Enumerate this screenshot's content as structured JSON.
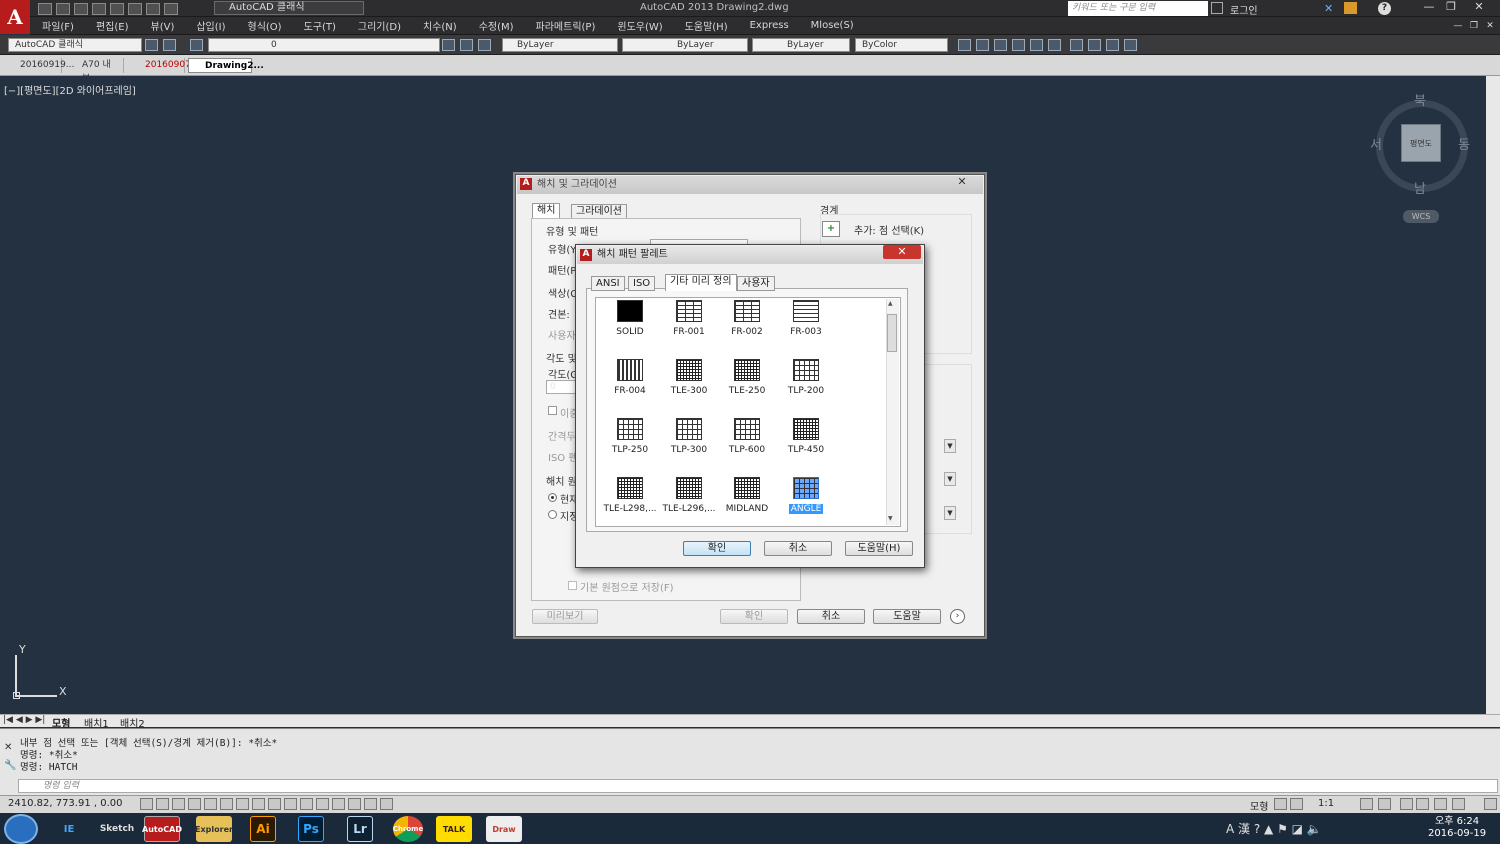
{
  "app": {
    "title": "AutoCAD 2013    Drawing2.dwg",
    "workspace": "AutoCAD 클래식",
    "search_placeholder": "키워드 또는 구문 입력",
    "login": "로그인",
    "logo_letter": "A"
  },
  "menu": [
    "파일(F)",
    "편집(E)",
    "뷰(V)",
    "삽입(I)",
    "형식(O)",
    "도구(T)",
    "그리기(D)",
    "치수(N)",
    "수정(M)",
    "파라메트릭(P)",
    "윈도우(W)",
    "도움말(H)",
    "Express",
    "Mlose(S)"
  ],
  "toolbar": {
    "workspace_combo": "AutoCAD 클래식",
    "layer_combo": "0",
    "color_combo": "ByLayer",
    "linetype_combo": "ByLayer",
    "lineweight_combo": "ByLayer",
    "plotstyle_combo": "ByColor"
  },
  "doc_tabs": [
    "20160919...",
    "A70 내부...",
    "20160907...",
    "Drawing2..."
  ],
  "view_label": "[−][평면도][2D 와이어프레임]",
  "navcube": {
    "north": "북",
    "south": "남",
    "west": "서",
    "east": "동",
    "face": "평면도",
    "wcs": "WCS"
  },
  "ucs": {
    "x": "X",
    "y": "Y"
  },
  "layout_tabs": [
    "모형",
    "배치1",
    "배치2"
  ],
  "command": {
    "lines": [
      "내부 점 선택 또는 [객체 선택(S)/경계 제거(B)]: *취소*",
      "명령: *취소*",
      "명령:  HATCH"
    ],
    "input_placeholder": "명령 입력"
  },
  "status": {
    "coords": "2410.82, 773.91 , 0.00",
    "model": "모형",
    "scale": "1:1"
  },
  "taskbar": {
    "time": "오후 6:24",
    "date": "2016-09-19",
    "apps": [
      "IE",
      "Sketch",
      "AutoCAD",
      "Explorer",
      "Ai",
      "Ps",
      "Lr",
      "Chrome",
      "TALK",
      "Draw"
    ]
  },
  "hatch_dialog": {
    "title": "해치 및 그라데이션",
    "tabs": [
      "해치",
      "그라데이션"
    ],
    "type_pattern_section": "유형 및 패턴",
    "labels_left": [
      "유형(Y)",
      "패턴(P)",
      "색상(C)",
      "견본:",
      "사용자"
    ],
    "angle_section": "각도 및",
    "angle_label": "각도(G)",
    "angle_value": "0",
    "labels_left2": [
      "이중",
      "간격두",
      "ISO 펜"
    ],
    "origin_section": "해치 원",
    "origin_opts": [
      "현재",
      "지정"
    ],
    "save_origin": "기본 원점으로 저장(F)",
    "boundaries_section": "경계",
    "add_pick": "추가: 점 선택(K)",
    "buttons": {
      "preview": "미리보기",
      "ok": "확인",
      "cancel": "취소",
      "help": "도움말"
    }
  },
  "palette_dialog": {
    "title": "해치 패턴 팔레트",
    "tabs": [
      "ANSI",
      "ISO",
      "기타 미리 정의",
      "사용자"
    ],
    "patterns": [
      "SOLID",
      "FR-001",
      "FR-002",
      "FR-003",
      "FR-004",
      "TLE-300",
      "TLE-250",
      "TLP-200",
      "TLP-250",
      "TLP-300",
      "TLP-600",
      "TLP-450",
      "TLE-L298,...",
      "TLE-L296,...",
      "MIDLAND",
      "ANGLE"
    ],
    "selected": "ANGLE",
    "buttons": {
      "ok": "확인",
      "cancel": "취소",
      "help": "도움말(H)"
    }
  }
}
